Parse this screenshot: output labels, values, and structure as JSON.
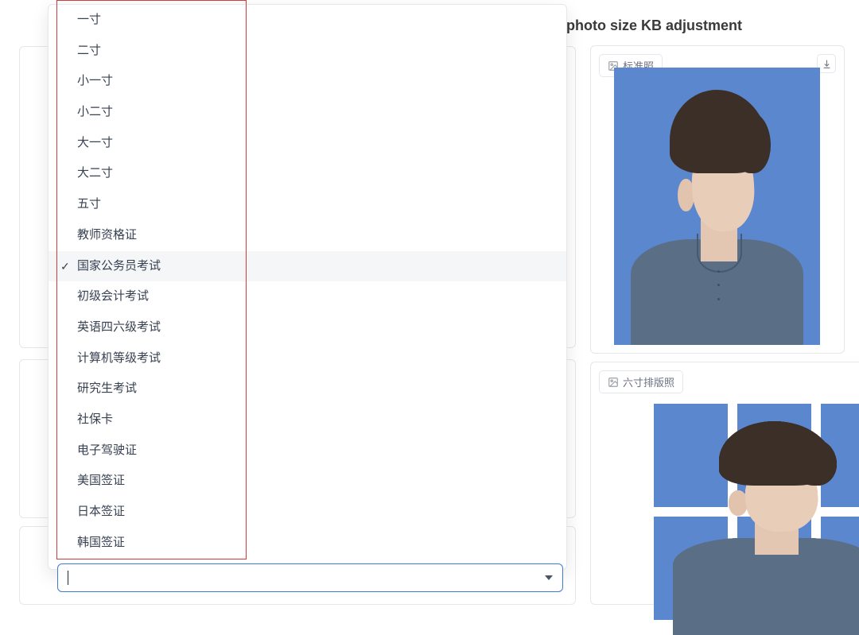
{
  "header": {
    "title_fragment": "photo size KB adjustment"
  },
  "dropdown": {
    "selected_index": 8,
    "options": [
      "一寸",
      "二寸",
      "小一寸",
      "小二寸",
      "大一寸",
      "大二寸",
      "五寸",
      "教师资格证",
      "国家公务员考试",
      "初级会计考试",
      "英语四六级考试",
      "计算机等级考试",
      "研究生考试",
      "社保卡",
      "电子驾驶证",
      "美国签证",
      "日本签证",
      "韩国签证"
    ],
    "input_value": ""
  },
  "preview": {
    "standard_badge": "标准照",
    "print_badge": "六寸排版照"
  },
  "colors": {
    "highlight_border": "#d23b3b",
    "focus_border": "#3e7bd6",
    "photo_bg": "#5b87cf"
  }
}
